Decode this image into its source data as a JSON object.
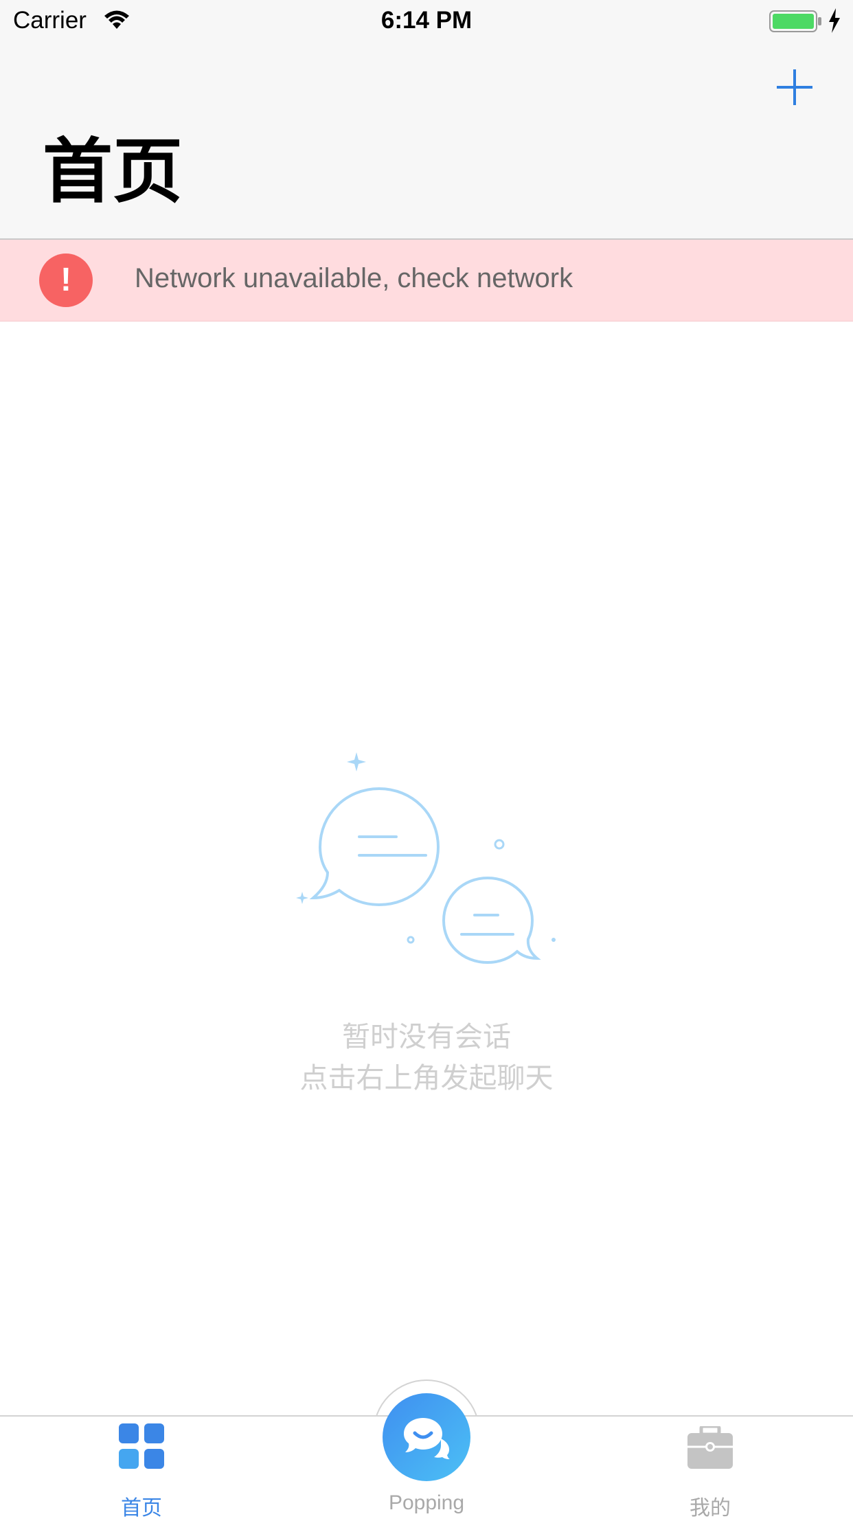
{
  "status_bar": {
    "carrier": "Carrier",
    "time": "6:14 PM"
  },
  "nav": {
    "title": "首页",
    "add_icon": "plus-icon"
  },
  "network_banner": {
    "icon": "alert-icon",
    "icon_glyph": "!",
    "message": "Network unavailable, check network"
  },
  "empty_state": {
    "line1": "暂时没有会话",
    "line2": "点击右上角发起聊天",
    "icon": "chat-bubbles-icon"
  },
  "tabbar": {
    "items": [
      {
        "label": "首页",
        "icon": "grid-icon",
        "active": true
      },
      {
        "label": "Popping",
        "icon": "chat-icon",
        "active": false
      },
      {
        "label": "我的",
        "icon": "briefcase-icon",
        "active": false
      }
    ]
  },
  "colors": {
    "accent": "#3b86e6",
    "error": "#f76363",
    "banner_bg": "#ffdcdf"
  }
}
